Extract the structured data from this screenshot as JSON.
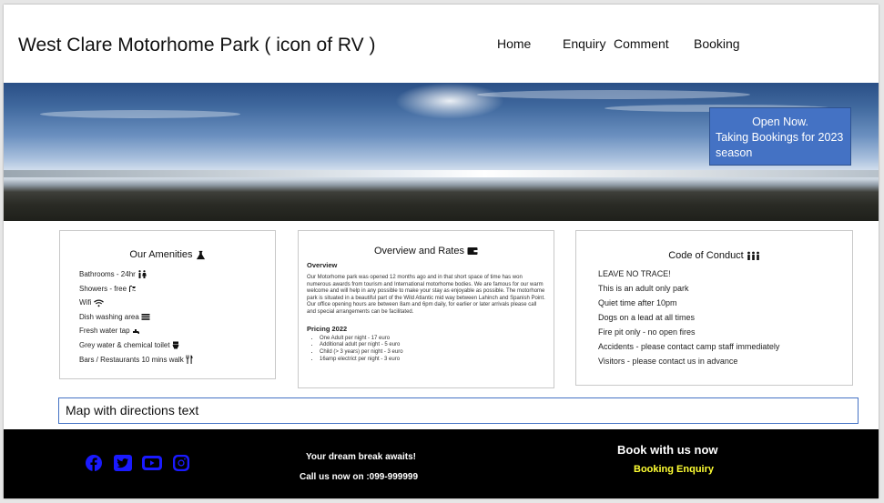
{
  "header": {
    "title": "West Clare Motorhome Park ( icon of RV )",
    "nav": [
      "Home",
      "Enquiry",
      "Comment",
      "Booking"
    ]
  },
  "hero": {
    "notice_line1": "Open Now.",
    "notice_line2": "Taking Bookings for 2023 season"
  },
  "amenities": {
    "title": "Our Amenities",
    "items": [
      {
        "label": "Bathrooms - 24hr",
        "icon": "restroom-icon"
      },
      {
        "label": "Showers - free",
        "icon": "shower-icon"
      },
      {
        "label": "Wifi",
        "icon": "wifi-icon"
      },
      {
        "label": "Dish washing area",
        "icon": "sink-icon"
      },
      {
        "label": "Fresh water tap",
        "icon": "faucet-icon"
      },
      {
        "label": "Grey water & chemical toilet",
        "icon": "toilet-icon"
      },
      {
        "label": "Bars / Restaurants 10 mins walk",
        "icon": "utensils-icon"
      }
    ]
  },
  "overview": {
    "title": "Overview and Rates",
    "subtitle": "Overview",
    "text": "Our Motorhome park was opened 12 months ago and in that short space of time has won numerous awards from tourism and International motorhome bodies. We are famous for our warm welcome and will help in any possible to make your stay as enjoyable as possible. The motorhome park is situated in a beautiful part of the Wild Atlantic mid way between Lahinch and Spanish Point. Our office opening hours are between 8am and 6pm daily, for earlier or later arrivals please call and special arrangements can be facilitated.",
    "pricing_title": "Pricing 2022",
    "prices": [
      "One Adult per night - 17 euro",
      "Additional adult per night - 5 euro",
      "Child (> 3 years) per night - 3 euro",
      "16amp electrict per night - 3 euro"
    ]
  },
  "conduct": {
    "title": "Code of Conduct",
    "items": [
      "LEAVE NO TRACE!",
      "This is an adult only park",
      "Quiet time after 10pm",
      "Dogs on a lead at all times",
      "Fire pit only - no open fires",
      "Accidents - please contact camp staff immediately",
      "Visitors - please contact us in advance"
    ]
  },
  "map": {
    "text": "Map with directions text"
  },
  "footer": {
    "social_icons": [
      "facebook-icon",
      "twitter-icon",
      "youtube-icon",
      "instagram-icon"
    ],
    "tagline": "Your dream break awaits!",
    "call": "Call us now on :099-999999",
    "book_title": "Book with us now",
    "book_link": "Booking Enquiry",
    "social_color": "#1a1aff",
    "link_color": "#ffff33"
  }
}
